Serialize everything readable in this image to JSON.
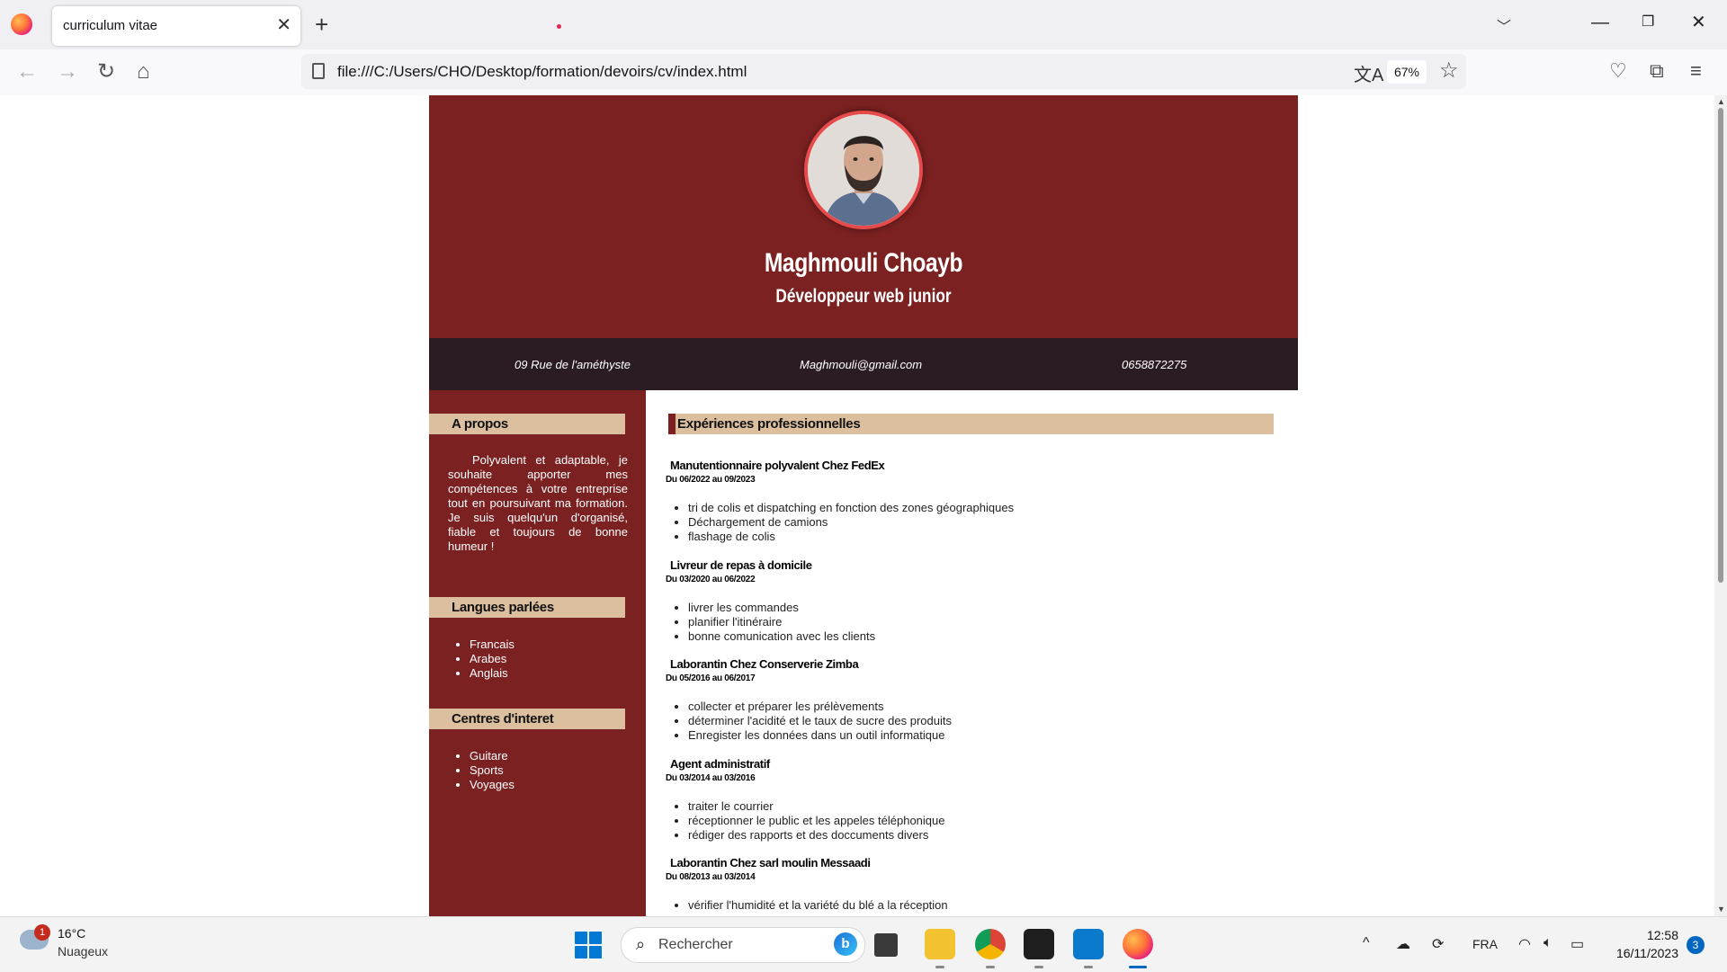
{
  "browser": {
    "tab_title": "curriculum vitae",
    "url": "file:///C:/Users/CHO/Desktop/formation/devoirs/cv/index.html",
    "zoom": "67%"
  },
  "cv": {
    "name": "Maghmouli Choayb",
    "role": "Développeur web junior",
    "contact": {
      "address": "09 Rue de l'améthyste",
      "email": "Maghmouli@gmail.com",
      "phone": "0658872275"
    },
    "sidebar": {
      "about_heading": "A propos",
      "about_text": "Polyvalent et adaptable, je souhaite apporter mes compétences à votre entreprise tout en poursuivant ma formation. Je suis quelqu'un d'organisé, fiable et toujours de bonne humeur !",
      "languages_heading": "Langues parlées",
      "languages": [
        "Francais",
        "Arabes",
        "Anglais"
      ],
      "interests_heading": "Centres d'interet",
      "interests": [
        "Guitare",
        "Sports",
        "Voyages"
      ]
    },
    "main": {
      "heading": "Expériences professionnelles",
      "jobs": [
        {
          "title": "Manutentionnaire polyvalent Chez FedEx",
          "dates": "Du 06/2022 au 09/2023",
          "tasks": [
            "tri de colis et dispatching en fonction des zones géographiques",
            "Déchargement de camions",
            "flashage de colis"
          ]
        },
        {
          "title": "Livreur de repas à domicile",
          "dates": "Du 03/2020 au 06/2022",
          "tasks": [
            "livrer les commandes",
            "planifier l'itinéraire",
            "bonne comunication avec les clients"
          ]
        },
        {
          "title": "Laborantin Chez Conserverie Zimba",
          "dates": "Du 05/2016 au 06/2017",
          "tasks": [
            "collecter et préparer les prélèvements",
            "déterminer l'acidité et le taux de sucre des produits",
            "Enregister les données dans un outil informatique"
          ]
        },
        {
          "title": "Agent administratif",
          "dates": "Du 03/2014 au 03/2016",
          "tasks": [
            "traiter le courrier",
            "réceptionner le public et les appeles téléphonique",
            "rédiger des rapports et des doccuments divers"
          ]
        },
        {
          "title": "Laborantin Chez sarl moulin Messaadi",
          "dates": "Du 08/2013 au 03/2014",
          "tasks": [
            "vérifier l'humidité et la variété du blé a la réception"
          ]
        }
      ]
    }
  },
  "taskbar": {
    "weather_temp": "16°C",
    "weather_desc": "Nuageux",
    "weather_badge": "1",
    "search_placeholder": "Rechercher",
    "language": "FRA",
    "time": "12:58",
    "date": "16/11/2023",
    "notifications": "3"
  },
  "colors": {
    "accent": "#7b2121",
    "heading_band": "#dcbf9f",
    "contact_bar": "#2a1c22"
  }
}
